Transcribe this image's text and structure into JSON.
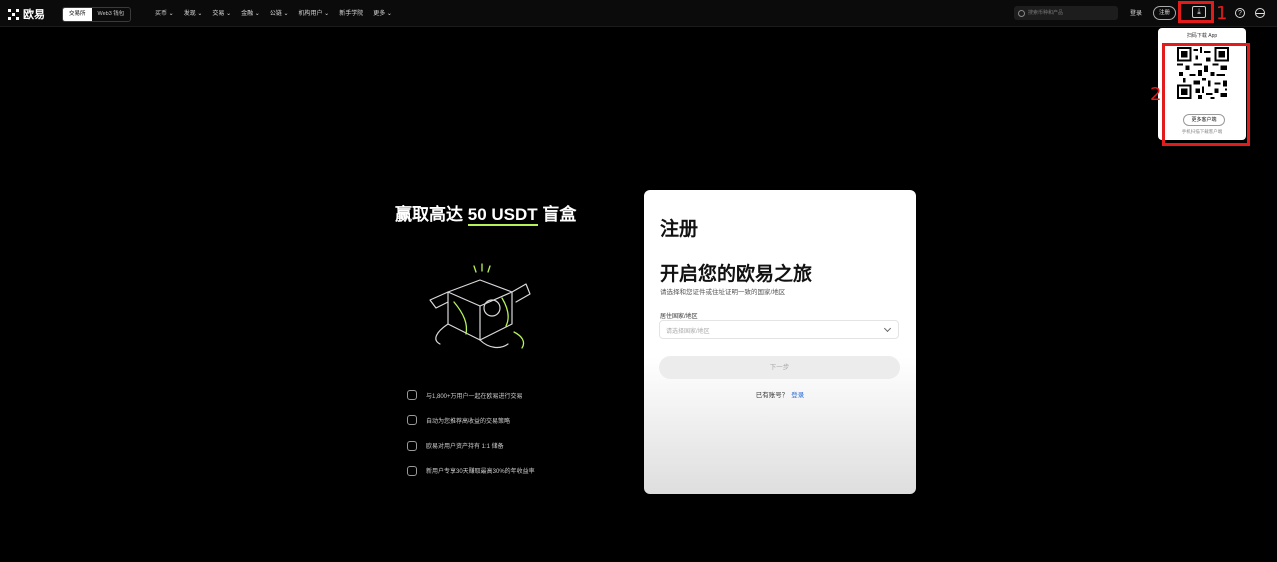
{
  "header": {
    "logo_text": "欧易",
    "segments": [
      "交易所",
      "Web3 钱包"
    ],
    "nav": [
      "买币 ⌄",
      "发现 ⌄",
      "交易 ⌄",
      "金融 ⌄",
      "公链 ⌄",
      "机构用户 ⌄",
      "新手学院",
      "更多 ⌄"
    ],
    "search_placeholder": "搜索币种和产品",
    "login": "登录",
    "register": "注册",
    "download_icon": "download-icon",
    "help_icon": "help-icon",
    "globe_icon": "globe-icon"
  },
  "annotations": {
    "label1": "1",
    "label2": "2",
    "color": "#e21b1b"
  },
  "download_popup": {
    "title": "扫码下载 App",
    "more_button": "更多客户端",
    "subtitle": "手机扫描下载客户端"
  },
  "promo": {
    "title_prefix": "赢取高达 ",
    "title_highlight": "50 USDT",
    "title_suffix": " 盲盒",
    "features": [
      "与1,800+万用户一起在欧易进行交易",
      "自动为您推荐高收益的交易策略",
      "欧易对用户资产持有 1:1 储备",
      "新用户专享30天赚取最高30%的年收益率"
    ],
    "accent_color": "#b6f25a"
  },
  "signup": {
    "heading": "注册",
    "subheading": "开启您的欧易之旅",
    "description": "请选择和您证件或住址证明一致的国家/地区",
    "field_label": "居住国家/地区",
    "field_placeholder": "请选择国家/地区",
    "next_button": "下一步",
    "has_account": "已有账号？",
    "login_link": "登录",
    "link_color": "#2a6bd6"
  }
}
